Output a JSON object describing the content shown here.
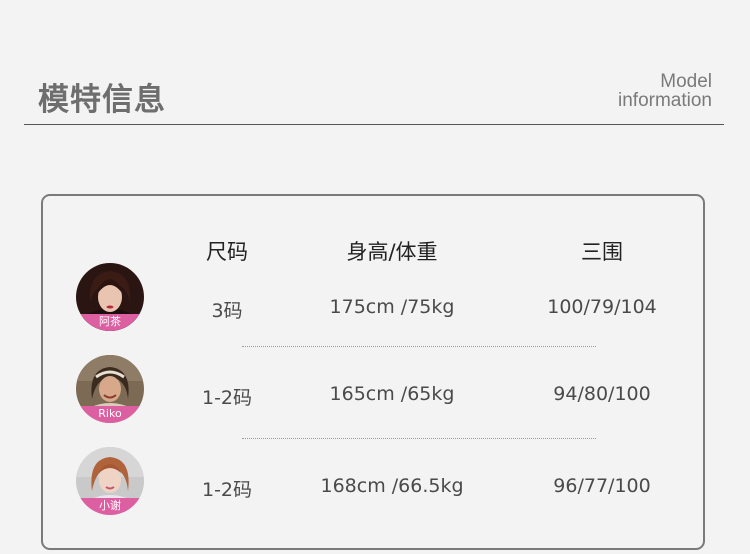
{
  "header": {
    "title_cn": "模特信息",
    "title_en_line1": "Model",
    "title_en_line2": "information"
  },
  "table": {
    "headers": {
      "size": "尺码",
      "height_weight": "身高/体重",
      "measurements": "三围"
    },
    "rows": [
      {
        "name": "阿茶",
        "size": "3码",
        "height_weight": "175cm /75kg",
        "measurements": "100/79/104"
      },
      {
        "name": "Riko",
        "size": "1-2码",
        "height_weight": "165cm /65kg",
        "measurements": "94/80/100"
      },
      {
        "name": "小谢",
        "size": "1-2码",
        "height_weight": "168cm /66.5kg",
        "measurements": "96/77/100"
      }
    ]
  },
  "colors": {
    "badge": "#dc5fa2",
    "background": "#f3f3f3",
    "border": "#7a7a7a"
  }
}
